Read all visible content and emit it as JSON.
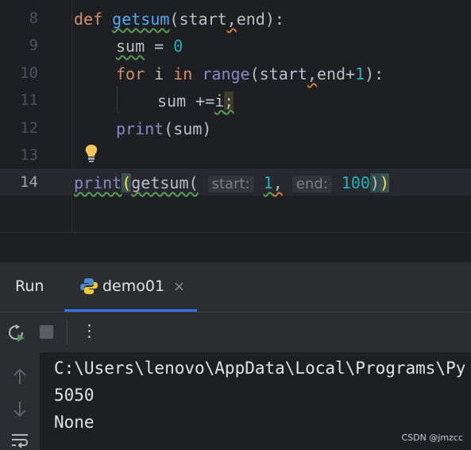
{
  "editor": {
    "lines": [
      {
        "num": "8"
      },
      {
        "num": "9"
      },
      {
        "num": "10"
      },
      {
        "num": "11"
      },
      {
        "num": "12"
      },
      {
        "num": "13"
      },
      {
        "num": "14"
      }
    ],
    "code": {
      "l8_kw": "def",
      "l8_name": "getsum",
      "l8_p1": "(start",
      "l8_comma": ",",
      "l8_p2": "end):",
      "l9_var": "sum",
      "l9_op": " = ",
      "l9_val": "0",
      "l10_kw1": "for",
      "l10_i": " i ",
      "l10_kw2": "in",
      "l10_sp": " ",
      "l10_range": "range",
      "l10_args1": "(start",
      "l10_comma": ",",
      "l10_args2": "end+",
      "l10_one": "1",
      "l10_end": "):",
      "l11_code": "sum +=",
      "l11_i": "i",
      "l11_semi": ";",
      "l12_print": "print",
      "l12_args": "(sum)",
      "l14_print": "print",
      "l14_open": "(",
      "l14_call": "getsum(",
      "l14_hint1": "start:",
      "l14_v1": "1",
      "l14_comma": ",",
      "l14_hint2": "end:",
      "l14_v2": "100",
      "l14_close1": ")",
      "l14_close2": ")"
    }
  },
  "run_panel": {
    "title": "Run",
    "tab_label": "demo01",
    "tab_close": "×",
    "toolbar_more": "⋮"
  },
  "console": {
    "lines": [
      "C:\\Users\\lenovo\\AppData\\Local\\Programs\\Py",
      "5050",
      "None"
    ]
  },
  "watermark": "CSDN @jmzcc",
  "colors": {
    "background": "#1e1f22",
    "panel": "#2b2d30",
    "keyword": "#cf8e6d",
    "function": "#56a8f5",
    "number": "#2aacb8",
    "builtin": "#8888c6",
    "accent": "#3574f0"
  }
}
